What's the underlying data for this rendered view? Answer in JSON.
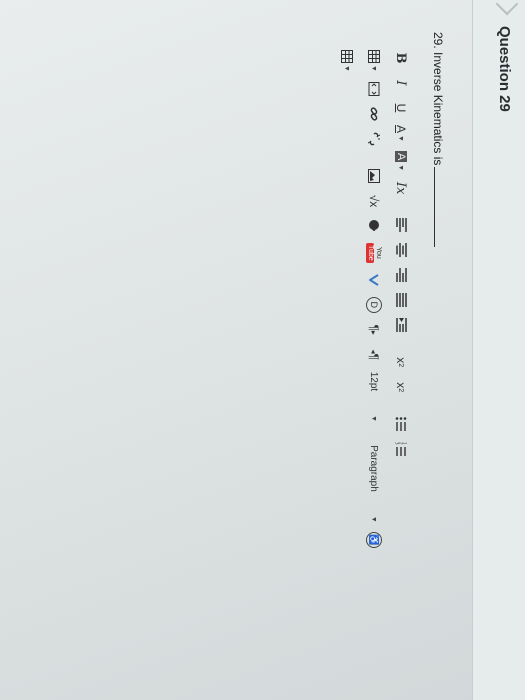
{
  "header": {
    "title": "Question 29"
  },
  "question": {
    "prompt": "29. Inverse Kinematics is"
  },
  "toolbar": {
    "bold": "B",
    "italic": "I",
    "underline": "U",
    "font_color": "A",
    "highlight": "A",
    "clear_format": "Ix",
    "superscript": "x",
    "superscript_mark": "2",
    "subscript": "x",
    "subscript_mark": "2",
    "font_size": "12pt",
    "block_format": "Paragraph",
    "pilcrow_ltr": "¶",
    "pilcrow_rtl": "¶",
    "sqrt": "√x",
    "youtube_top": "You",
    "youtube_bottom": "Tube",
    "video": "D",
    "accessibility": "♿"
  }
}
